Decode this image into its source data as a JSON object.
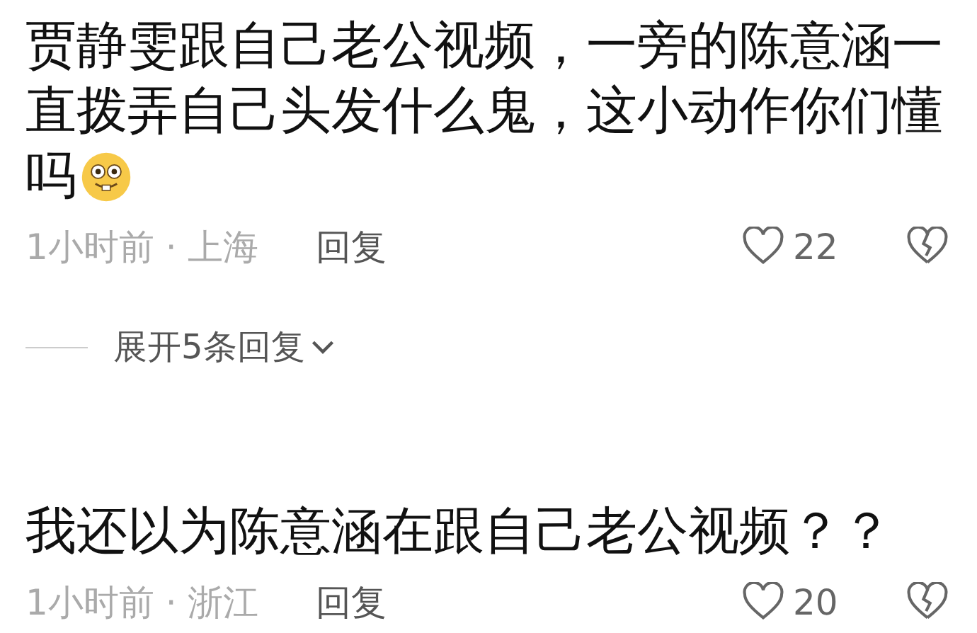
{
  "comments": [
    {
      "text": "贾静雯跟自己老公视频，一旁的陈意涵一直拨弄自己头发什么鬼，这小动作你们懂吗",
      "emoji": true,
      "time": "1小时前",
      "separator": "·",
      "location": "上海",
      "reply": "回复",
      "likes": "22",
      "replies_toggle": "展开5条回复"
    },
    {
      "text": "我还以为陈意涵在跟自己老公视频？？",
      "emoji": false,
      "time": "1小时前",
      "separator": "·",
      "location": "浙江",
      "reply": "回复",
      "likes": "20"
    }
  ]
}
